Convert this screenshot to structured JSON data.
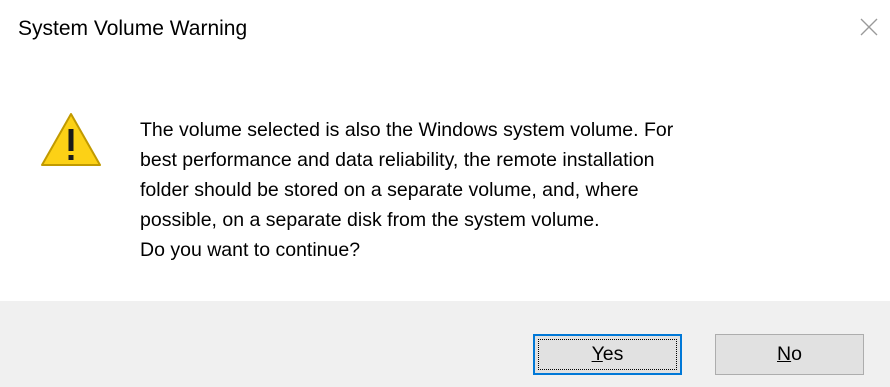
{
  "dialog": {
    "title": "System Volume Warning",
    "close_icon": "close-icon",
    "warning_icon": "warning-triangle-icon",
    "message_lines": [
      "The volume selected is also the Windows system volume. For",
      "best performance and data reliability, the remote installation",
      "folder should be stored on a separate volume, and, where",
      "possible, on a separate disk from the system volume.",
      "Do you want to continue?"
    ],
    "buttons": {
      "yes": {
        "mnemonic": "Y",
        "rest": "es"
      },
      "no": {
        "mnemonic": "N",
        "rest": "o"
      }
    },
    "colors": {
      "warning_fill": "#fcd116",
      "warning_stroke": "#c19a00",
      "footer_bg": "#f0f0f0",
      "default_border": "#0078d7"
    }
  }
}
